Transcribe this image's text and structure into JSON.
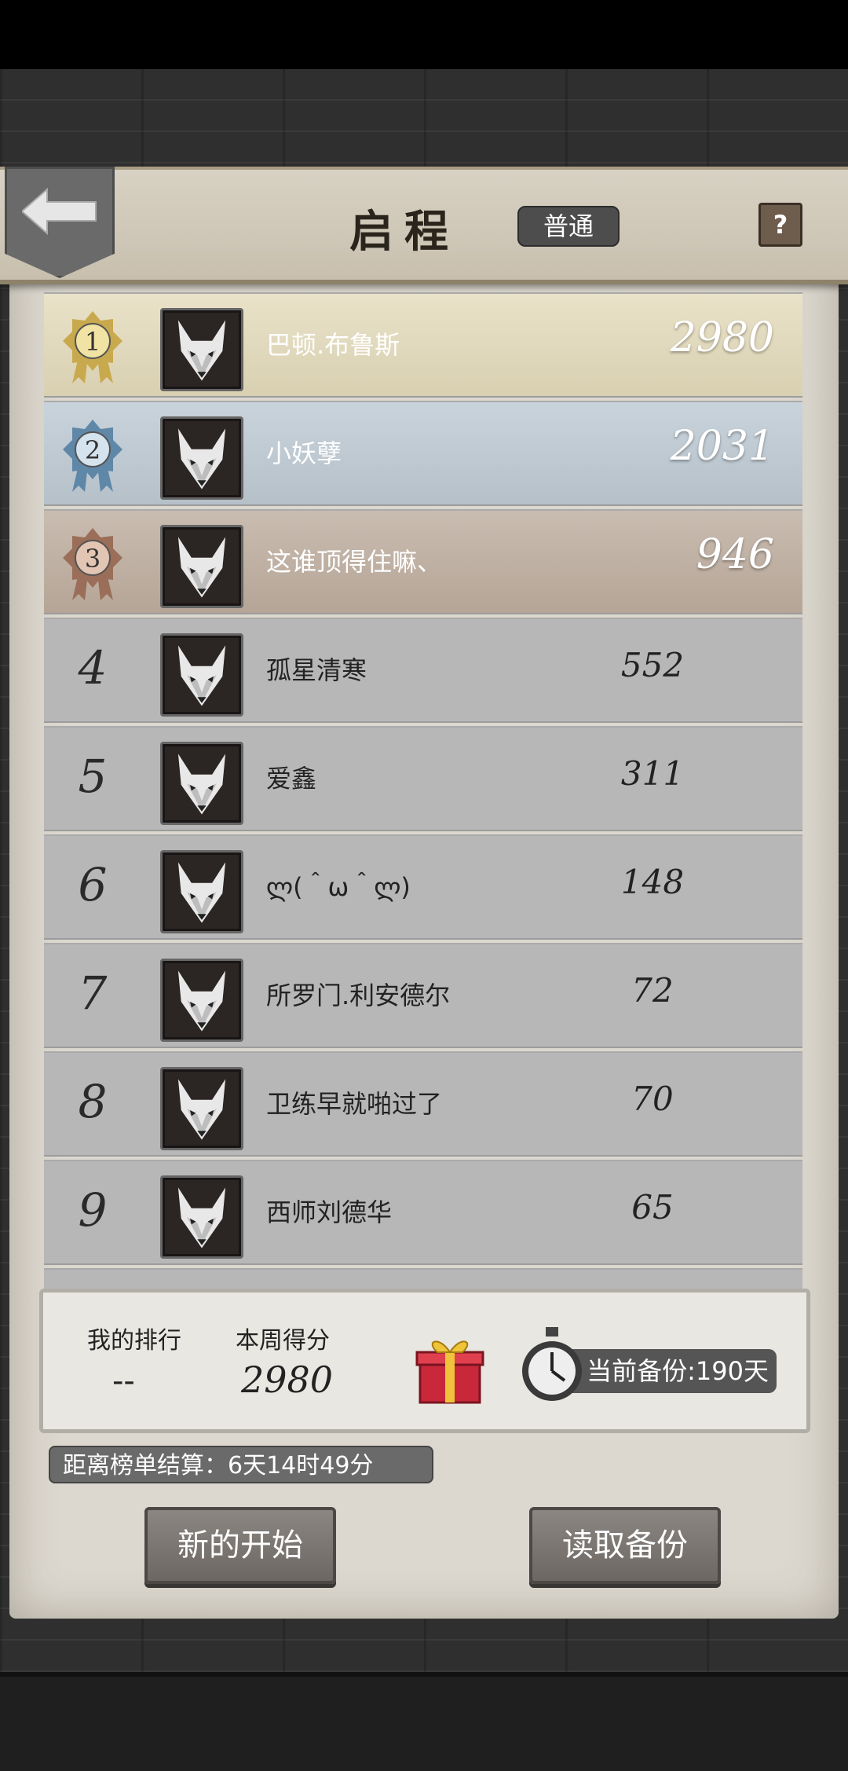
{
  "header": {
    "title": "启程",
    "mode": "普通",
    "help": "?"
  },
  "ranking": [
    {
      "rank": "1",
      "name": "巴顿.布鲁斯",
      "score": "2980",
      "tier": "gold"
    },
    {
      "rank": "2",
      "name": "小妖孽",
      "score": "2031",
      "tier": "silver"
    },
    {
      "rank": "3",
      "name": "这谁顶得住嘛、",
      "score": "946",
      "tier": "bronze"
    },
    {
      "rank": "4",
      "name": "孤星清寒",
      "score": "552",
      "tier": "plain"
    },
    {
      "rank": "5",
      "name": "爱鑫",
      "score": "311",
      "tier": "plain"
    },
    {
      "rank": "6",
      "name": "ლ(＾ω＾ლ)",
      "score": "148",
      "tier": "plain"
    },
    {
      "rank": "7",
      "name": "所罗门.利安德尔",
      "score": "72",
      "tier": "plain"
    },
    {
      "rank": "8",
      "name": "卫练早就啪过了",
      "score": "70",
      "tier": "plain"
    },
    {
      "rank": "9",
      "name": "西师刘德华",
      "score": "65",
      "tier": "plain"
    }
  ],
  "mine": {
    "rank_label": "我的排行",
    "rank_value": "--",
    "score_label": "本周得分",
    "score_value": "2980",
    "backup_text": "当前备份:190天"
  },
  "countdown": "距离榜单结算：6天14时49分",
  "buttons": {
    "new_start": "新的开始",
    "load_backup": "读取备份"
  }
}
